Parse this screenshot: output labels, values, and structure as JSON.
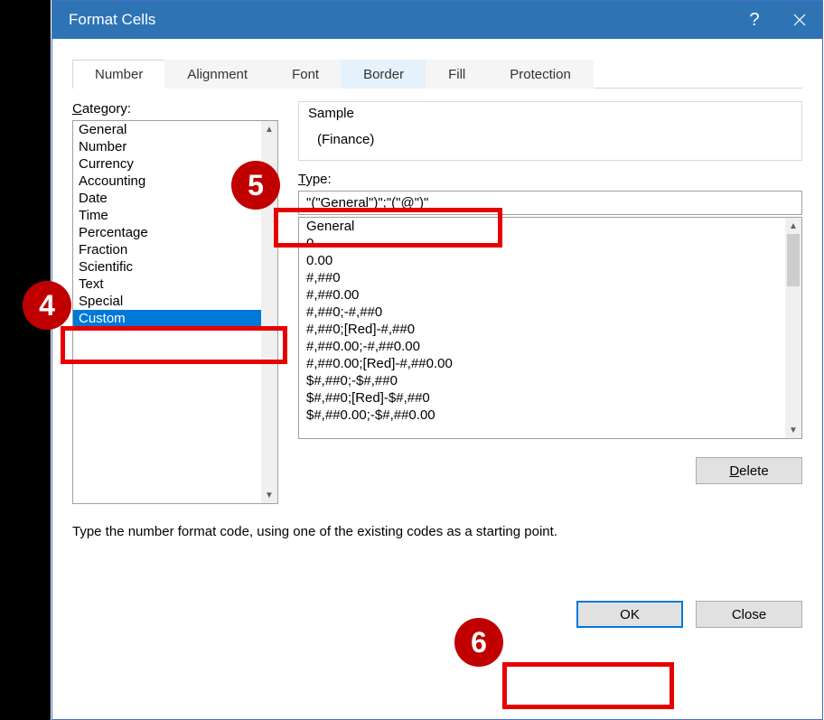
{
  "titlebar": {
    "title": "Format Cells"
  },
  "tabs": [
    {
      "label": "Number",
      "active": true
    },
    {
      "label": "Alignment"
    },
    {
      "label": "Font"
    },
    {
      "label": "Border",
      "hover": true
    },
    {
      "label": "Fill"
    },
    {
      "label": "Protection"
    }
  ],
  "category": {
    "label_pre": "C",
    "label_rest": "ategory:",
    "items": [
      "General",
      "Number",
      "Currency",
      "Accounting",
      "Date",
      "Time",
      "Percentage",
      "Fraction",
      "Scientific",
      "Text",
      "Special",
      "Custom"
    ],
    "selected_index": 11
  },
  "sample": {
    "label": "Sample",
    "value": "(Finance)"
  },
  "type": {
    "label_pre": "T",
    "label_rest": "ype:",
    "value": "\"(\"General\")\";\"(\"@\")\""
  },
  "formats": [
    "General",
    "0",
    "0.00",
    "#,##0",
    "#,##0.00",
    "#,##0;-#,##0",
    "#,##0;[Red]-#,##0",
    "#,##0.00;-#,##0.00",
    "#,##0.00;[Red]-#,##0.00",
    "$#,##0;-$#,##0",
    "$#,##0;[Red]-$#,##0",
    "$#,##0.00;-$#,##0.00"
  ],
  "delete": {
    "pre": "D",
    "rest": "elete"
  },
  "help_text": "Type the number format code, using one of the existing codes as a starting point.",
  "footer": {
    "ok": "OK",
    "close": "Close"
  },
  "callouts": {
    "c4": "4",
    "c5": "5",
    "c6": "6"
  }
}
